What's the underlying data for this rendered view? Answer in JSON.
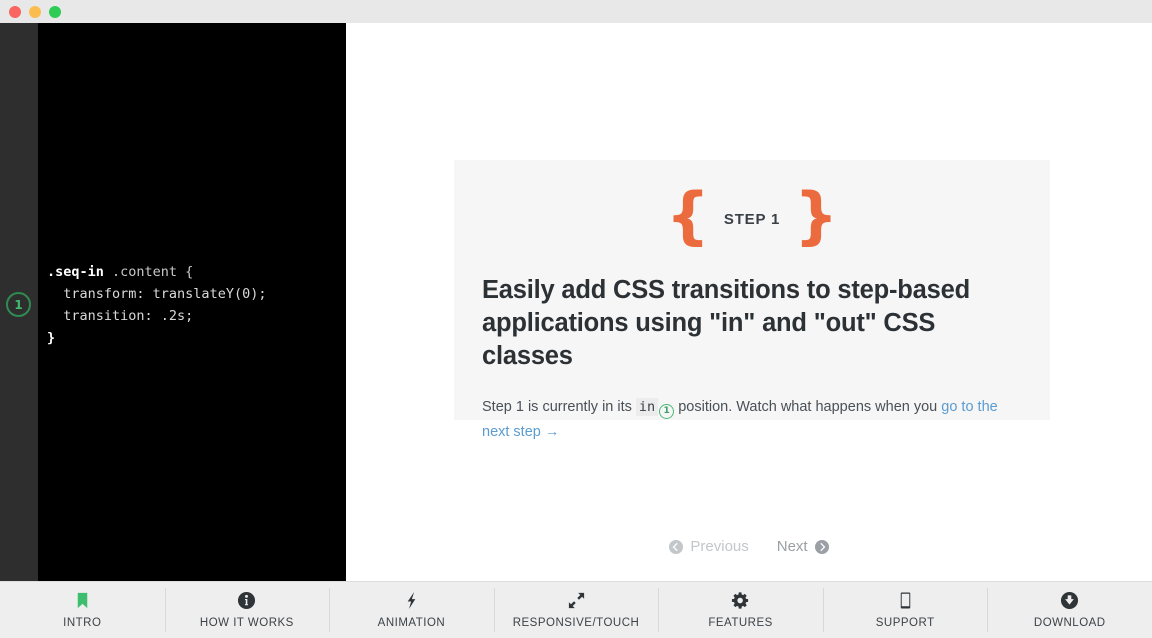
{
  "window": {
    "traffic_lights": [
      "close",
      "minimize",
      "maximize"
    ]
  },
  "code_panel": {
    "gutter_badge": "1",
    "lines": [
      {
        "selector": ".seq-in",
        "rest": " .content {"
      },
      {
        "indent": "  ",
        "text": "transform: translateY(0);"
      },
      {
        "indent": "  ",
        "text": "transition: .2s;"
      },
      {
        "text": "}"
      }
    ],
    "full_text": ".seq-in .content {\n  transform: translateY(0);\n  transition: .2s;\n}"
  },
  "card": {
    "eyebrow": {
      "left_brace": "{",
      "label": "STEP 1",
      "right_brace": "}"
    },
    "headline": "Easily add CSS transitions to step-based applications using \"in\" and \"out\" CSS classes",
    "body": {
      "before_code": "Step 1 is currently in its ",
      "code": "in",
      "badge": "1",
      "after_code": " position. Watch what happens when you ",
      "link": "go to the next step →"
    }
  },
  "pager": {
    "previous": {
      "label": "Previous",
      "icon": "chevron-left-circle-icon",
      "disabled": true
    },
    "next": {
      "label": "Next",
      "icon": "chevron-right-circle-icon",
      "disabled": false
    }
  },
  "bottom_nav": {
    "items": [
      {
        "label": "INTRO",
        "icon": "bookmark-icon",
        "active": true
      },
      {
        "label": "HOW IT WORKS",
        "icon": "info-circle-icon",
        "active": false
      },
      {
        "label": "ANIMATION",
        "icon": "lightning-bolt-icon",
        "active": false
      },
      {
        "label": "RESPONSIVE/TOUCH",
        "icon": "expand-arrows-icon",
        "active": false
      },
      {
        "label": "FEATURES",
        "icon": "gear-icon",
        "active": false
      },
      {
        "label": "SUPPORT",
        "icon": "tablet-icon",
        "active": false
      },
      {
        "label": "DOWNLOAD",
        "icon": "download-circle-icon",
        "active": false
      }
    ]
  },
  "colors": {
    "accent_orange": "#ec6b3e",
    "accent_green": "#3dbd6e",
    "link_blue": "#5b9cd0",
    "code_bg": "#000000",
    "gutter": "#2e2e2e",
    "card_bg": "#f6f6f6",
    "nav_bg": "#eeeeee",
    "titlebar_bg": "#e8e8e8"
  }
}
